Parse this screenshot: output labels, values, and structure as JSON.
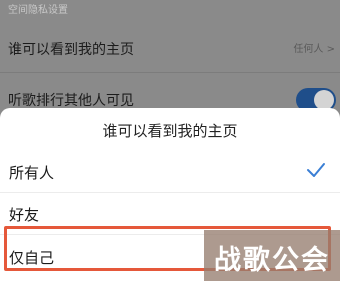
{
  "background": {
    "section_label": "空间隐私设置",
    "rows": [
      {
        "title": "谁可以看到我的主页",
        "value": "任何人 >"
      },
      {
        "title": "听歌排行其他人可见",
        "toggle_on": true
      }
    ]
  },
  "sheet": {
    "title": "谁可以看到我的主页",
    "options": [
      {
        "label": "所有人",
        "selected": true
      },
      {
        "label": "好友",
        "selected": false
      },
      {
        "label": "仅自己",
        "selected": false
      }
    ]
  },
  "highlight_color": "#e5583a",
  "watermark": {
    "text": "战歌公会"
  },
  "icons": {
    "selected": "check-icon"
  }
}
